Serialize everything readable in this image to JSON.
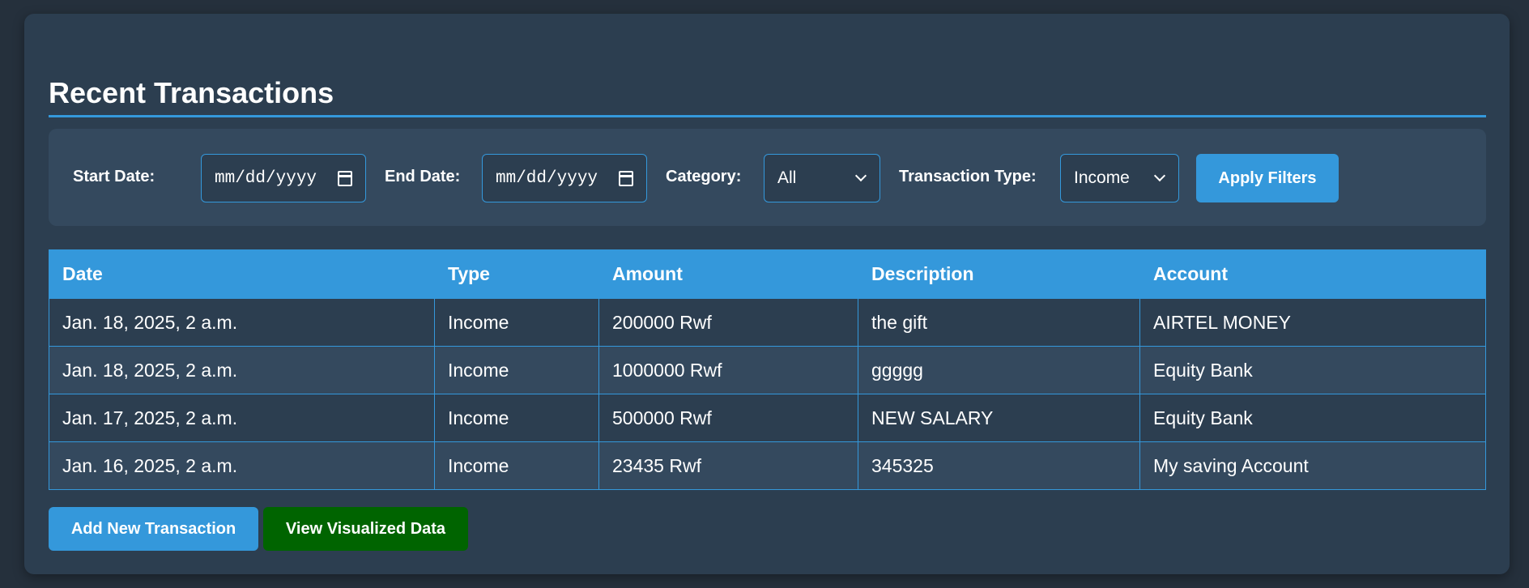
{
  "page": {
    "title": "Recent Transactions"
  },
  "filters": {
    "start_date_label": "Start Date:",
    "start_date_placeholder": "mm/dd/yyyy",
    "end_date_label": "End Date:",
    "end_date_placeholder": "mm/dd/yyyy",
    "category_label": "Category:",
    "category_value": "All",
    "type_label": "Transaction Type:",
    "type_value": "Income",
    "apply_label": "Apply Filters"
  },
  "table": {
    "columns": [
      "Date",
      "Type",
      "Amount",
      "Description",
      "Account"
    ],
    "rows": [
      [
        "Jan. 18, 2025, 2 a.m.",
        "Income",
        "200000 Rwf",
        "the gift",
        "AIRTEL MONEY"
      ],
      [
        "Jan. 18, 2025, 2 a.m.",
        "Income",
        "1000000 Rwf",
        "ggggg",
        "Equity Bank"
      ],
      [
        "Jan. 17, 2025, 2 a.m.",
        "Income",
        "500000 Rwf",
        "NEW SALARY",
        "Equity Bank"
      ],
      [
        "Jan. 16, 2025, 2 a.m.",
        "Income",
        "23435 Rwf",
        "345325",
        "My saving Account"
      ]
    ]
  },
  "actions": {
    "add_label": "Add New Transaction",
    "view_label": "View Visualized Data"
  },
  "colors": {
    "background": "#25303c",
    "card": "#2c3e50",
    "panel": "#34495e",
    "accent": "#3498db",
    "green_button": "#006400"
  },
  "icons": {
    "date_picker": "calendar-icon",
    "select": "chevron-down-icon"
  }
}
